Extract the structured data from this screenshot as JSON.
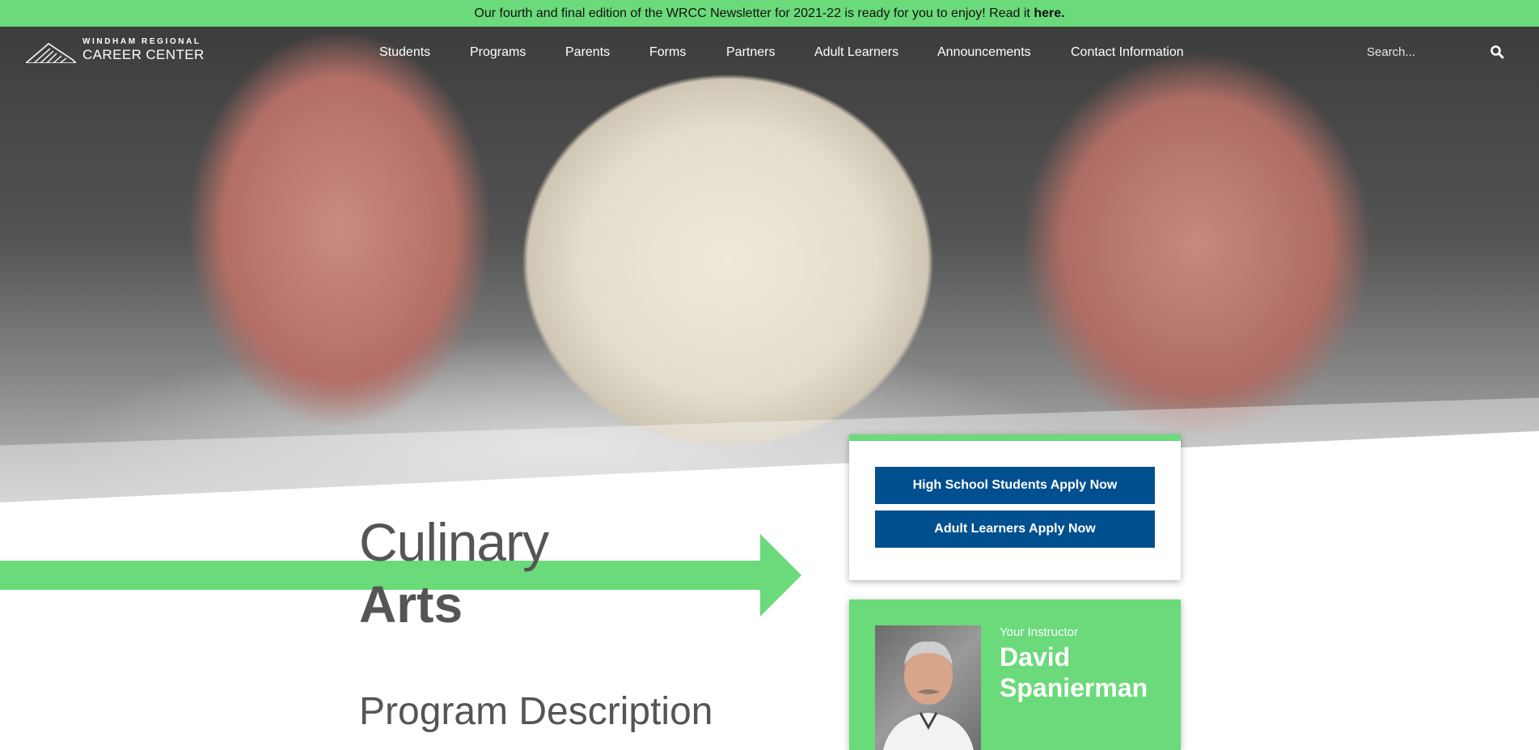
{
  "announcement": {
    "text": "Our fourth and final edition of the WRCC Newsletter for 2021-22 is ready for you to enjoy!  Read it ",
    "link": "here."
  },
  "header": {
    "logo_line1": "WINDHAM REGIONAL",
    "logo_line2": "CAREER CENTER",
    "nav": [
      "Students",
      "Programs",
      "Parents",
      "Forms",
      "Partners",
      "Adult Learners",
      "Announcements",
      "Contact Information"
    ],
    "search_placeholder": "Search..."
  },
  "page": {
    "title_line1": "Culinary",
    "title_line2": "Arts",
    "section_heading": "Program Description"
  },
  "apply": {
    "high_school": "High School Students Apply Now",
    "adult": "Adult Learners Apply Now"
  },
  "instructor": {
    "label": "Your Instructor",
    "name": "David Spanierman"
  },
  "colors": {
    "accent_green": "#6ada7a",
    "button_blue": "#00508f",
    "heading_gray": "#555555"
  },
  "icons": [
    "logo-mark-icon",
    "search-icon",
    "arrow-icon"
  ]
}
